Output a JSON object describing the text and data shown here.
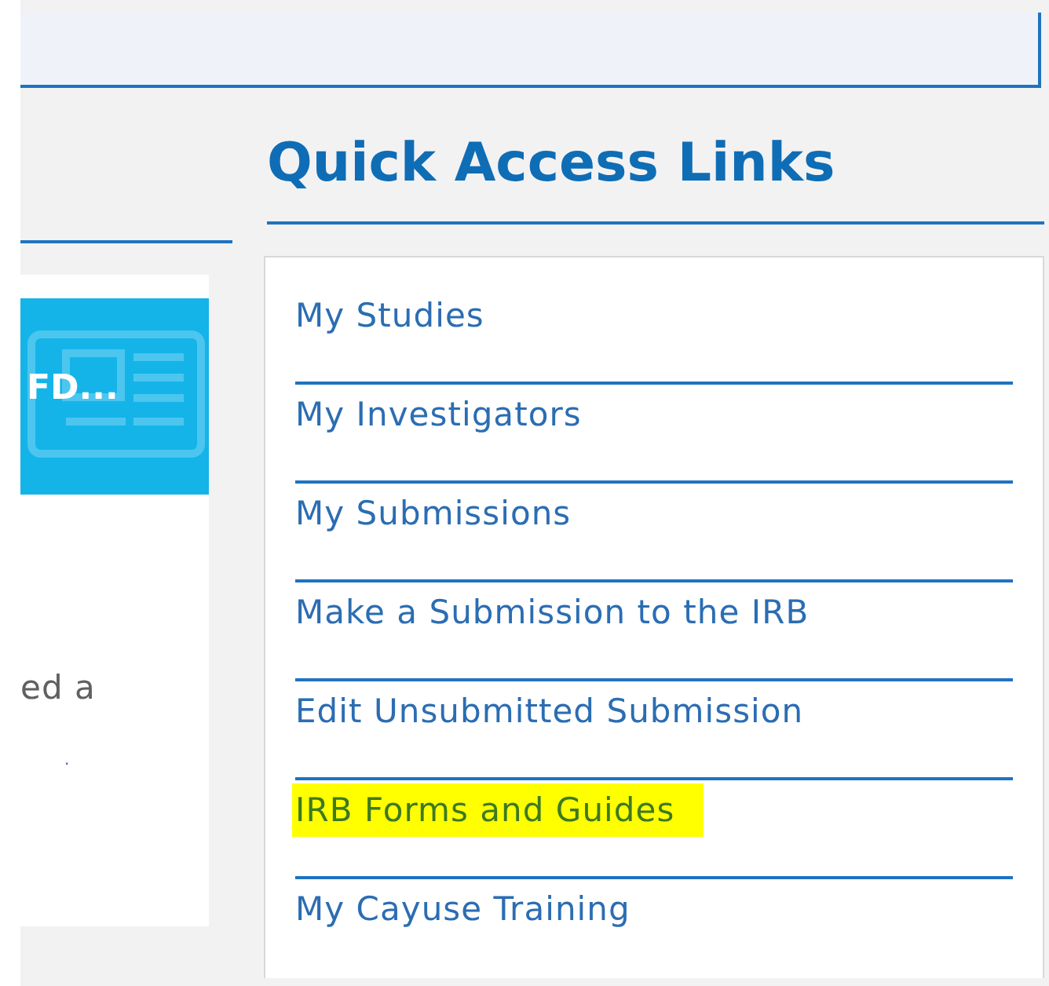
{
  "left_card": {
    "tile_title": "FD...",
    "text_lines": [
      "ed a",
      "."
    ]
  },
  "quick_access": {
    "title": "Quick Access Links",
    "links": [
      {
        "label": "My Studies",
        "highlighted": false
      },
      {
        "label": "My Investigators",
        "highlighted": false
      },
      {
        "label": "My Submissions",
        "highlighted": false
      },
      {
        "label": "Make a Submission to the IRB",
        "highlighted": false
      },
      {
        "label": "Edit Unsubmitted Submission",
        "highlighted": false
      },
      {
        "label": "IRB Forms and Guides",
        "highlighted": true
      },
      {
        "label": "My Cayuse Training",
        "highlighted": false
      }
    ]
  }
}
